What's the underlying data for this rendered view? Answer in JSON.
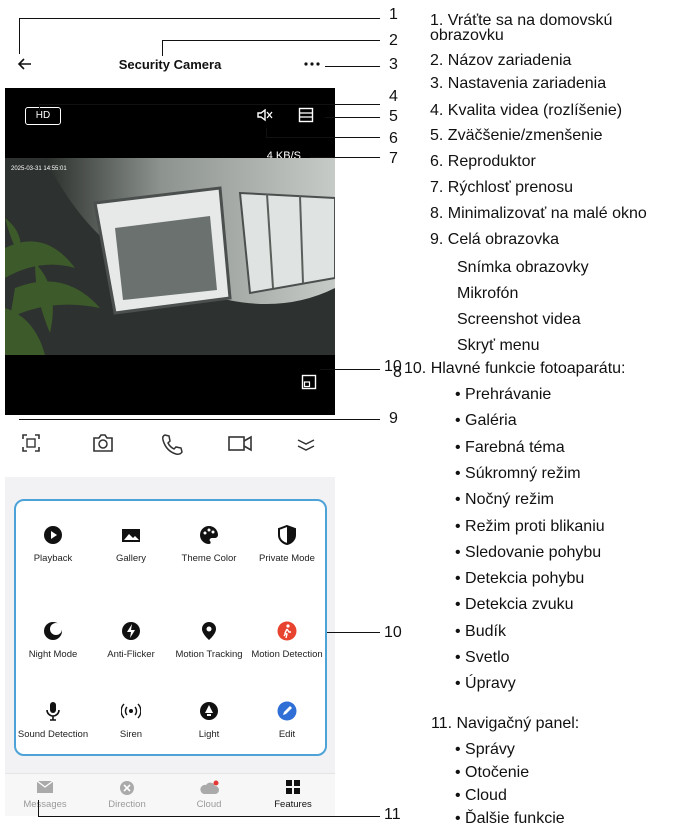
{
  "app": {
    "title": "Security Camera",
    "hd_label": "HD",
    "speed": "4 KB/S",
    "timestamp": "2025-03-31 14:55:01"
  },
  "features": [
    {
      "label": "Playback",
      "icon": "play-icon"
    },
    {
      "label": "Gallery",
      "icon": "image-icon"
    },
    {
      "label": "Theme Color",
      "icon": "palette-icon"
    },
    {
      "label": "Private Mode",
      "icon": "shield-icon"
    },
    {
      "label": "Night Mode",
      "icon": "moon-icon"
    },
    {
      "label": "Anti-Flicker",
      "icon": "bolt-icon"
    },
    {
      "label": "Motion Tracking",
      "icon": "pin-icon"
    },
    {
      "label": "Motion Detection",
      "icon": "walker-icon"
    },
    {
      "label": "Sound Detection",
      "icon": "mic-icon"
    },
    {
      "label": "Siren",
      "icon": "siren-icon"
    },
    {
      "label": "Light",
      "icon": "bulb-icon"
    },
    {
      "label": "Edit",
      "icon": "pencil-icon"
    }
  ],
  "nav": [
    {
      "label": "Messages",
      "icon": "mail-icon"
    },
    {
      "label": "Direction",
      "icon": "direction-icon"
    },
    {
      "label": "Cloud",
      "icon": "cloud-icon"
    },
    {
      "label": "Features",
      "icon": "grid-icon"
    }
  ],
  "callouts": {
    "n1": "1",
    "n2": "2",
    "n3": "3",
    "n4": "4",
    "n5": "5",
    "n6": "6",
    "n7": "7",
    "n8": "8",
    "n9": "9",
    "n10": "10",
    "n11": "11"
  },
  "legend": {
    "l1a": "1. Vráťte sa na domovskú",
    "l1b": "obrazovku",
    "l2": "2. Názov zariadenia",
    "l3": "3. Nastavenia zariadenia",
    "l4": "4. Kvalita videa (rozlíšenie)",
    "l5": "5. Zväčšenie/zmenšenie",
    "l6": "6. Reproduktor",
    "l7": "7. Rýchlosť prenosu",
    "l8": "8. Minimalizovať na malé okno",
    "l9": "9. Celá obrazovka",
    "s1": "Snímka obrazovky",
    "s2": "Mikrofón",
    "s3": "Screenshot videa",
    "s4": "Skryť menu",
    "l10": "10. Hlavné funkcie fotoaparátu:",
    "f": [
      "Prehrávanie",
      "Galéria",
      "Farebná téma",
      "Súkromný režim",
      "Nočný režim",
      "Režim proti blikaniu",
      "Sledovanie pohybu",
      "Detekcia pohybu",
      "Detekcia zvuku",
      "Budík",
      "Svetlo",
      "Úpravy"
    ],
    "l11": "11. Navigačný panel:",
    "n": [
      "Správy",
      "Otočenie",
      "Cloud",
      "Ďalšie funkcie"
    ]
  }
}
